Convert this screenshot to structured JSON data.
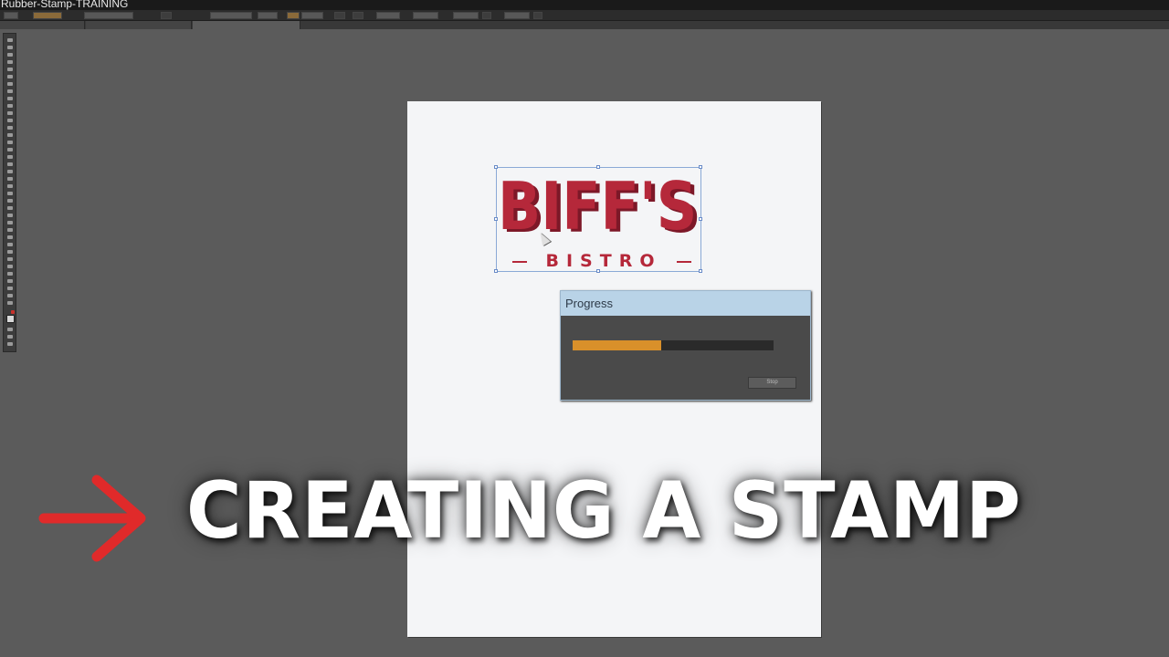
{
  "window": {
    "title": "Rubber-Stamp-TRAINING"
  },
  "tabs": [
    {
      "label": ""
    },
    {
      "label": ""
    },
    {
      "label": ""
    }
  ],
  "canvas": {
    "logo_main": "BIFF'S",
    "logo_sub": "BISTRO"
  },
  "progress_dialog": {
    "title": "Progress",
    "progress": 0.44,
    "status": "",
    "stop_label": "Stop"
  },
  "overlay": {
    "caption": "CREATING A STAMP",
    "arrow_color": "#e02a2a"
  },
  "colors": {
    "logo_red": "#b5283a",
    "progress_orange": "#d9902a",
    "dialog_title_bg": "#b9d3e7",
    "workspace_bg": "#5b5b5b"
  }
}
